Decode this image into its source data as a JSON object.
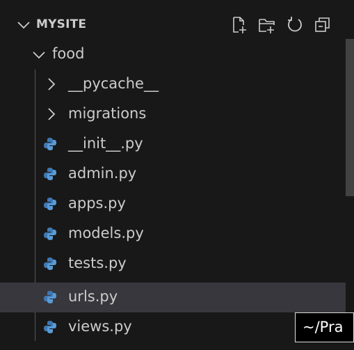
{
  "explorer": {
    "section_title": "MYSITE",
    "actions": [
      "new-file-icon",
      "new-folder-icon",
      "refresh-icon",
      "collapse-all-icon"
    ],
    "root_folder": "food",
    "items": [
      {
        "label": "__pycache__",
        "type": "folder"
      },
      {
        "label": "migrations",
        "type": "folder"
      },
      {
        "label": "__init__.py",
        "type": "python"
      },
      {
        "label": "admin.py",
        "type": "python"
      },
      {
        "label": "apps.py",
        "type": "python"
      },
      {
        "label": "models.py",
        "type": "python"
      },
      {
        "label": "tests.py",
        "type": "python"
      },
      {
        "label": "urls.py",
        "type": "python",
        "selected": true
      },
      {
        "label": "views.py",
        "type": "python"
      }
    ]
  },
  "tooltip": {
    "text": "~/Pra"
  },
  "colors": {
    "background": "#181818",
    "selected_row": "#37373d",
    "text": "#cccccc",
    "python_icon": "#3e78b2"
  }
}
